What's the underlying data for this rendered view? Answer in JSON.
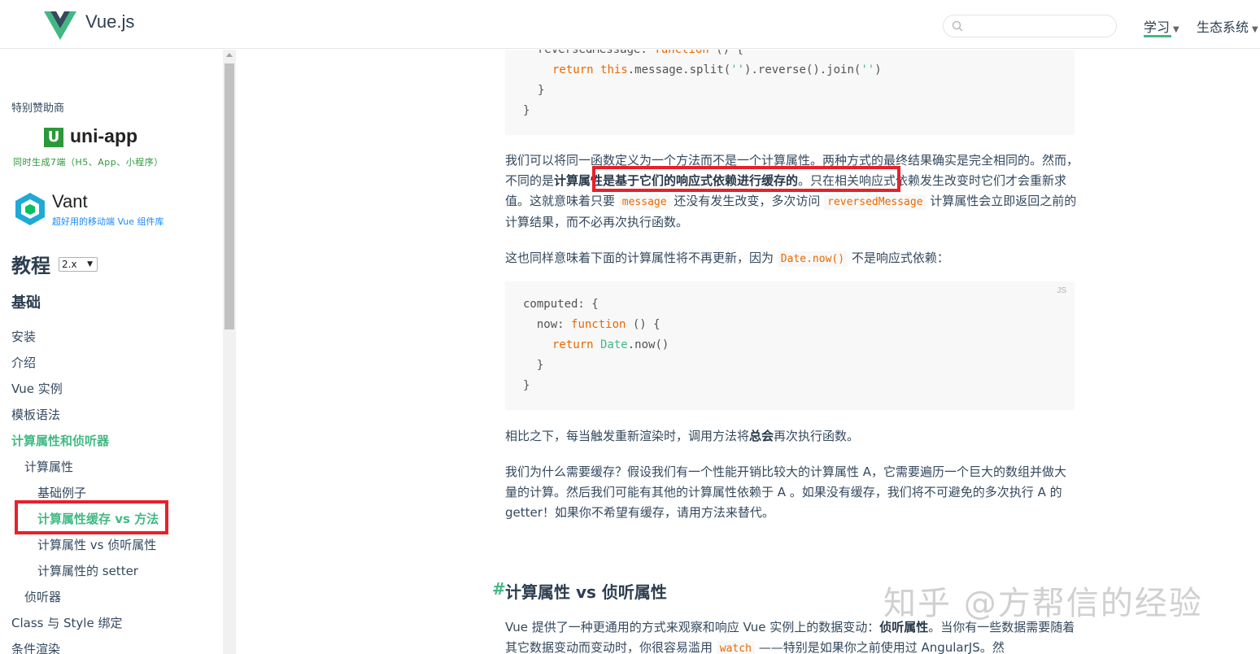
{
  "header": {
    "brand": "Vue.js",
    "search_placeholder": "",
    "nav": [
      {
        "label": "学习"
      },
      {
        "label": "生态系统"
      }
    ],
    "accent_color": "#42b983"
  },
  "sidebar": {
    "sponsor_label": "特别赞助商",
    "sponsors": [
      {
        "name": "uni-app",
        "logo_letter": "U",
        "tagline": "同时生成7端（H5、App、小程序）"
      },
      {
        "name": "Vant",
        "tagline": "超好用的移动端 Vue 组件库"
      }
    ],
    "tutorial_title": "教程",
    "version": "2.x",
    "section_title": "基础",
    "items": [
      {
        "label": "安装"
      },
      {
        "label": "介绍"
      },
      {
        "label": "Vue 实例"
      },
      {
        "label": "模板语法"
      },
      {
        "label": "计算属性和侦听器"
      },
      {
        "label": "计算属性"
      },
      {
        "label": "基础例子"
      },
      {
        "label": "计算属性缓存 vs 方法"
      },
      {
        "label": "计算属性 vs 侦听属性"
      },
      {
        "label": "计算属性的 setter"
      },
      {
        "label": "侦听器"
      },
      {
        "label": "Class 与 Style 绑定"
      },
      {
        "label": "条件渲染"
      }
    ]
  },
  "main": {
    "code1": {
      "lines": [
        {
          "plain1": "reversedMessage: ",
          "kw": "function",
          "plain2": " () {"
        },
        {
          "indent": "  ",
          "kw": "return",
          "plain1": " ",
          "kw2": "this",
          "plain2": ".message.split(",
          "str": "''",
          "plain3": ").reverse().join(",
          "str2": "''",
          "plain4": ")"
        },
        {
          "plain1": "}"
        },
        {
          "plain1": "}"
        }
      ]
    },
    "p1": {
      "a": "我们可以将同一函数定义为一个方法而不是一个计算属性。两种方式的最终结果确实是完全相同的。然而，不同的是",
      "b": "计算属性是基于它们的响应式依赖进行缓存的",
      "c": "。只在相关响应式依赖发生改变时它们才会重新求值。这就意味着只要 ",
      "code1": "message",
      "d": " 还没有发生改变，多次访问 ",
      "code2": "reversedMessage",
      "e": " 计算属性会立即返回之前的计算结果，而不必再次执行函数。"
    },
    "p2": {
      "a": "这也同样意味着下面的计算属性将不再更新，因为 ",
      "code": "Date.now()",
      "b": " 不是响应式依赖："
    },
    "code2": {
      "lang": "JS",
      "l1": "computed: {",
      "l2a": "  now: ",
      "l2kw": "function",
      "l2b": " () {",
      "l3kw": "return",
      "l3b": "Date",
      "l3c": ".now()",
      "l4": "  }",
      "l5": "}"
    },
    "p3": {
      "a": "相比之下，每当触发重新渲染时，调用方法将",
      "b": "总会",
      "c": "再次执行函数。"
    },
    "p4": "我们为什么需要缓存？假设我们有一个性能开销比较大的计算属性 A，它需要遍历一个巨大的数组并做大量的计算。然后我们可能有其他的计算属性依赖于 A 。如果没有缓存，我们将不可避免的多次执行 A 的 getter！如果你不希望有缓存，请用方法来替代。",
    "h2_hash": "#",
    "h2": "计算属性 vs 侦听属性",
    "p5": {
      "a": "Vue 提供了一种更通用的方式来观察和响应 Vue 实例上的数据变动：",
      "b": "侦听属性",
      "c": "。当你有一些数据需要随着其它数据变动而变动时，你很容易滥用 ",
      "code": "watch",
      "d": " ——特别是如果你之前使用过 AngularJS。然"
    },
    "watermark": "知乎 @方帮信的经验"
  }
}
